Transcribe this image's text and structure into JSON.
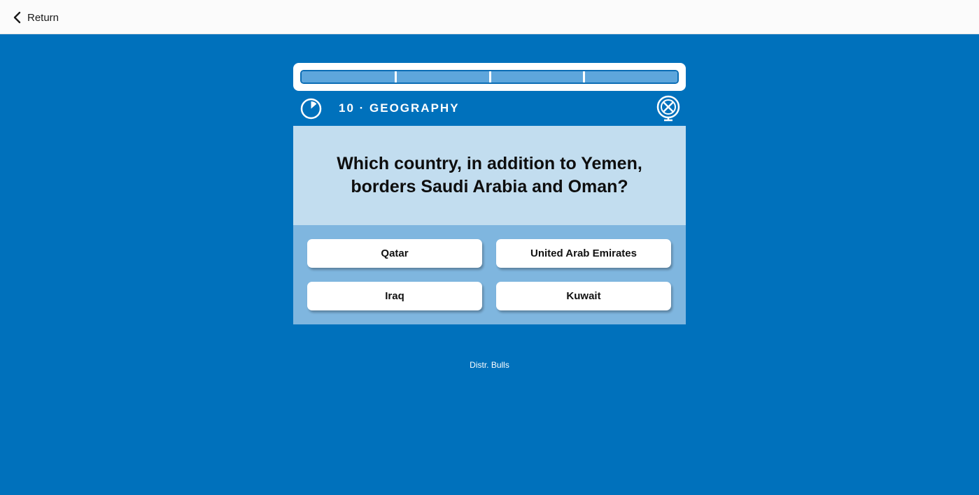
{
  "header": {
    "return_label": "Return",
    "return_icon": "chevron-left-icon"
  },
  "quiz": {
    "progress": 1.0,
    "progress_segments": 4,
    "timer_icon": "timer-icon",
    "category": "10 · GEOGRAPHY",
    "globe_icon": "globe-icon",
    "question": "Which country, in addition to Yemen, borders Saudi Arabia and Oman?",
    "answers": [
      {
        "label": "Qatar"
      },
      {
        "label": "United Arab Emirates"
      },
      {
        "label": "Iraq"
      },
      {
        "label": "Kuwait"
      }
    ]
  },
  "footer": {
    "credit": "Distr. Bulls"
  },
  "colors": {
    "background": "#0071bc",
    "question_bg": "#c2ddef",
    "answers_bg": "#7fb6df",
    "progress_fill": "#5ea6dc",
    "topbar_bg": "#fbfbfb"
  }
}
